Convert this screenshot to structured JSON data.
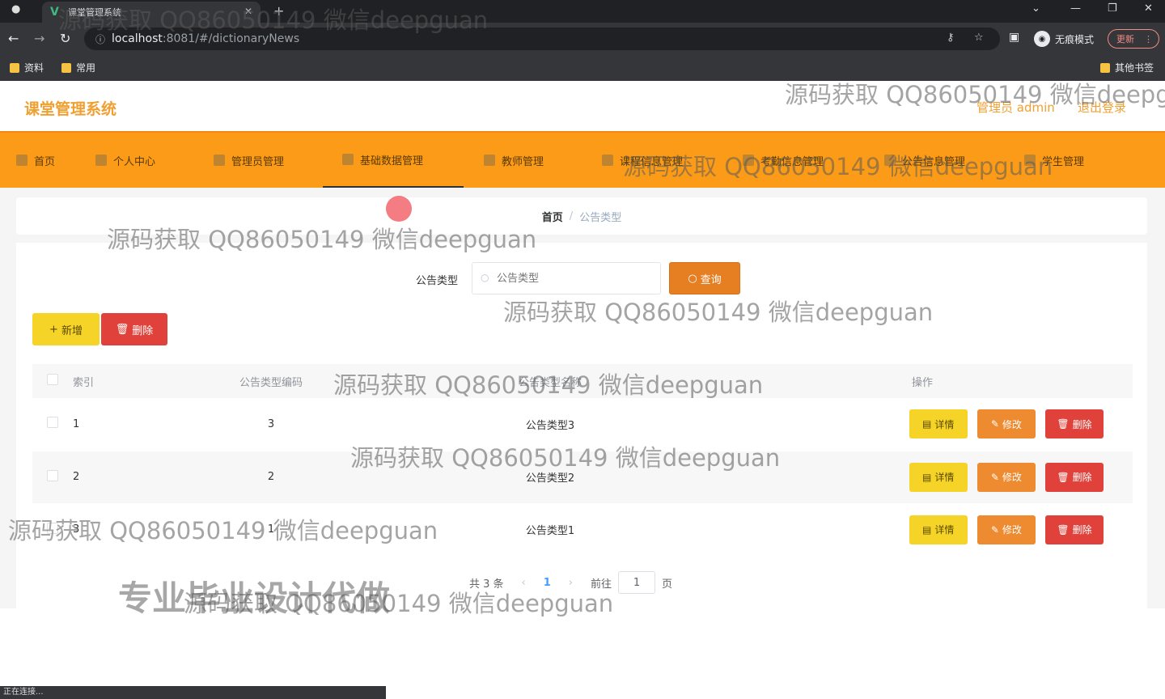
{
  "browser": {
    "tab_title": "课堂管理系统",
    "tab_close": "✕",
    "new_tab": "+",
    "url_host": "localhost",
    "url_rest": ":8081/#/dictionaryNews",
    "incognito_label": "无痕模式",
    "update_label": "更新",
    "bookmarks": [
      "资料",
      "常用"
    ],
    "other_bookmarks": "其他书签",
    "status_text": "正在连接..."
  },
  "header": {
    "logo": "课堂管理系统",
    "user": "管理员 admin",
    "logout": "退出登录"
  },
  "nav": {
    "items": [
      "首页",
      "个人中心",
      "管理员管理",
      "基础数据管理",
      "教师管理",
      "课程信息管理",
      "考勤信息管理",
      "公告信息管理",
      "学生管理"
    ],
    "active": "基础数据管理"
  },
  "breadcrumb": {
    "home": "首页",
    "separator": "/",
    "current": "公告类型"
  },
  "search": {
    "label": "公告类型",
    "placeholder": "公告类型",
    "button": "查询"
  },
  "actions": {
    "add": "新增",
    "delete": "删除"
  },
  "table": {
    "headers": [
      "索引",
      "公告类型编码",
      "公告类型名称",
      "操作"
    ],
    "rows": [
      {
        "index": "1",
        "code": "3",
        "name": "公告类型3"
      },
      {
        "index": "2",
        "code": "2",
        "name": "公告类型2"
      },
      {
        "index": "3",
        "code": "1",
        "name": "公告类型1"
      }
    ],
    "row_buttons": {
      "detail": "详情",
      "edit": "修改",
      "remove": "删除"
    }
  },
  "pagination": {
    "total": "共 3 条",
    "current_page": "1",
    "goto_label": "前往",
    "goto_value": "1",
    "page_suffix": "页"
  },
  "watermark": {
    "text": "源码获取 QQ86050149 微信deepguan",
    "big_text": "专业毕业设计代做"
  }
}
